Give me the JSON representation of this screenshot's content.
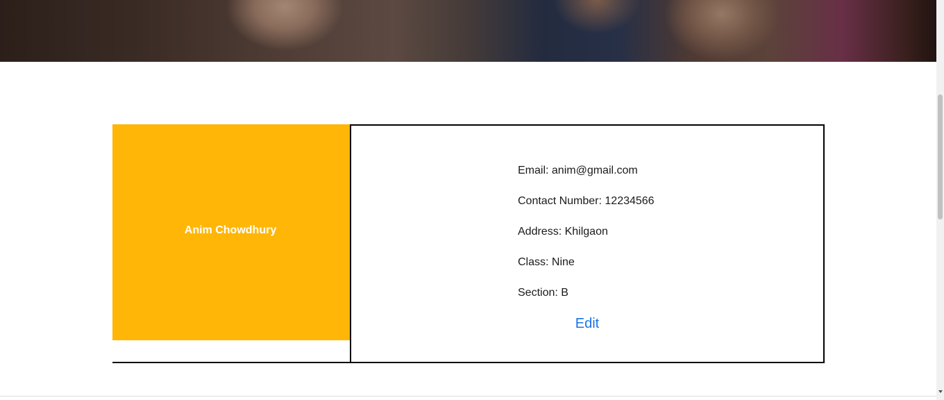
{
  "profile": {
    "name": "Anim Chowdhury",
    "fields": [
      {
        "label": "Email:",
        "value": "anim@gmail.com"
      },
      {
        "label": "Contact Number:",
        "value": "12234566"
      },
      {
        "label": "Address:",
        "value": "Khilgaon"
      },
      {
        "label": "Class:",
        "value": "Nine"
      },
      {
        "label": "Section:",
        "value": "B"
      }
    ],
    "edit_label": "Edit"
  },
  "colors": {
    "accent": "#ffb606",
    "link": "#1a73e8"
  }
}
